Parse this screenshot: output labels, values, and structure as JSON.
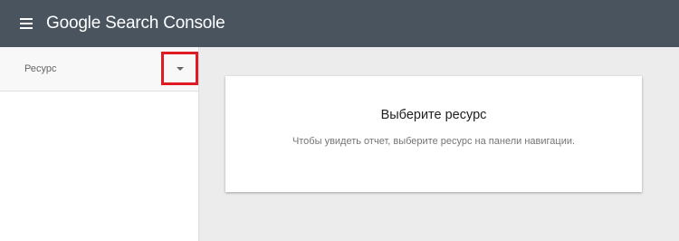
{
  "app": {
    "title": "Google Search Console"
  },
  "sidebar": {
    "resource_label": "Ресурс"
  },
  "main": {
    "card_title": "Выберите ресурс",
    "card_text": "Чтобы увидеть отчет, выберите ресурс на панели навигации."
  },
  "icons": {
    "menu": "menu-icon",
    "dropdown": "chevron-down-icon"
  },
  "colors": {
    "header_bg": "#4a545f",
    "highlight": "#e01b24"
  }
}
